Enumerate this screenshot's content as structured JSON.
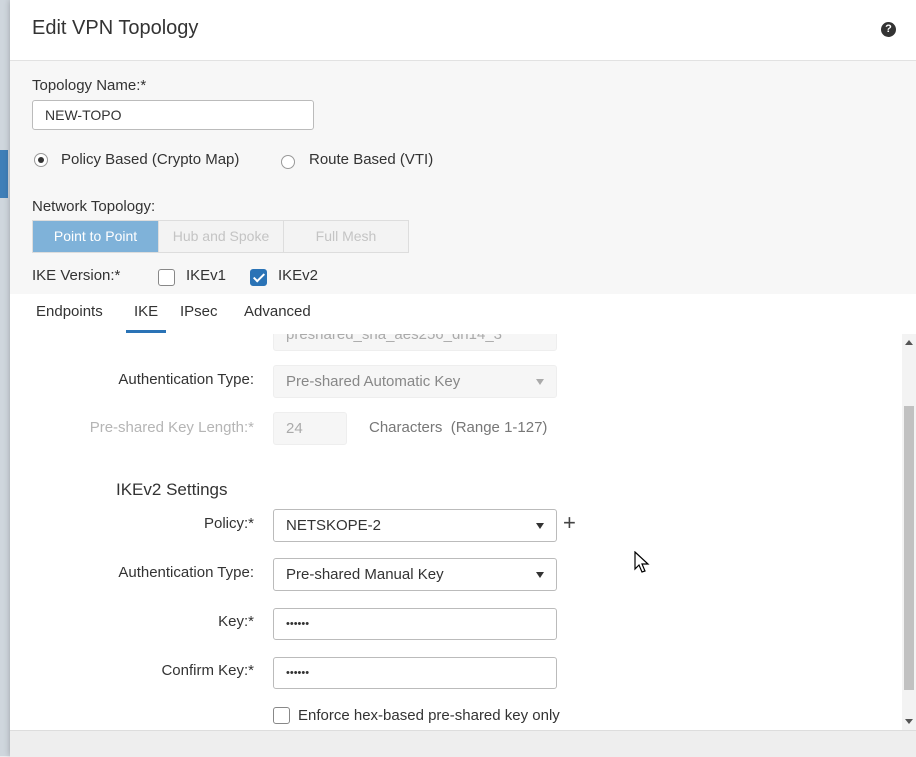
{
  "dialog": {
    "title": "Edit VPN Topology",
    "help_icon": "help-icon"
  },
  "topology_name": {
    "label": "Topology Name:*",
    "value": "NEW-TOPO"
  },
  "policy_mode": {
    "options": [
      {
        "label": "Policy Based (Crypto Map)",
        "selected": true
      },
      {
        "label": "Route Based (VTI)",
        "selected": false
      }
    ]
  },
  "network_topology": {
    "label": "Network Topology:",
    "options": [
      "Point to Point",
      "Hub and Spoke",
      "Full Mesh"
    ],
    "selected": "Point to Point"
  },
  "ike_version": {
    "label": "IKE Version:*",
    "ikev1": {
      "label": "IKEv1",
      "checked": false
    },
    "ikev2": {
      "label": "IKEv2",
      "checked": true
    }
  },
  "tabs": [
    {
      "label": "Endpoints",
      "active": false
    },
    {
      "label": "IKE",
      "active": true
    },
    {
      "label": "IPsec",
      "active": false
    },
    {
      "label": "Advanced",
      "active": false
    }
  ],
  "ikev1_settings": {
    "policy_value_partial": "preshared_sha_aes256_dh14_3",
    "auth_type_label": "Authentication Type:",
    "auth_type_value": "Pre-shared Automatic Key",
    "key_length_label": "Pre-shared Key Length:*",
    "key_length_value": "24",
    "key_length_hint": "Characters",
    "key_length_range": "(Range 1-127)"
  },
  "ikev2_settings": {
    "heading": "IKEv2 Settings",
    "policy_label": "Policy:*",
    "policy_value": "NETSKOPE-2",
    "auth_type_label": "Authentication Type:",
    "auth_type_value": "Pre-shared Manual Key",
    "key_label": "Key:*",
    "key_value": "••••••",
    "confirm_key_label": "Confirm Key:*",
    "confirm_key_value": "••••••",
    "enforce_hex_label": "Enforce hex-based pre-shared key only",
    "enforce_hex_checked": false
  },
  "colors": {
    "accent": "#2a73b6",
    "segment_active": "#7fb2d9"
  }
}
